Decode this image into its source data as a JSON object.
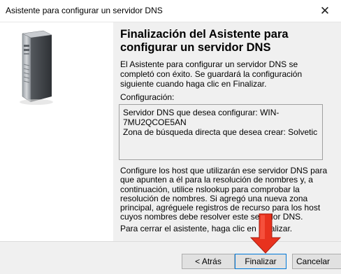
{
  "window": {
    "title": "Asistente para configurar un servidor DNS",
    "close_icon": "close-icon"
  },
  "left": {
    "icon": "server-icon"
  },
  "main": {
    "heading": "Finalización del Asistente para configurar un servidor DNS",
    "intro": "El Asistente para configurar un servidor DNS se completó con éxito. Se guardará la configuración siguiente cuando haga clic en Finalizar.",
    "config_label": "Configuración:",
    "config_lines": [
      "Servidor DNS que desea configurar: WIN-",
      "7MU2QCOE5AN",
      "Zona de búsqueda directa que desea crear: Solvetic"
    ],
    "note": "Configure los host que utilizarán ese servidor DNS para que apunten a él para la resolución de nombres y, a continuación, utilice nslookup para comprobar la resolución de nombres. Si agregó una nueva zona principal, agréguele registros de recurso para los host cuyos nombres debe resolver este servidor DNS.",
    "finish_hint": "Para cerrar el asistente, haga clic en Finalizar."
  },
  "buttons": {
    "back": "< Atrás",
    "finish": "Finalizar",
    "cancel": "Cancelar"
  },
  "colors": {
    "accent": "#0078d7",
    "arrow": "#e8321e",
    "panel": "#f0f0f0"
  }
}
